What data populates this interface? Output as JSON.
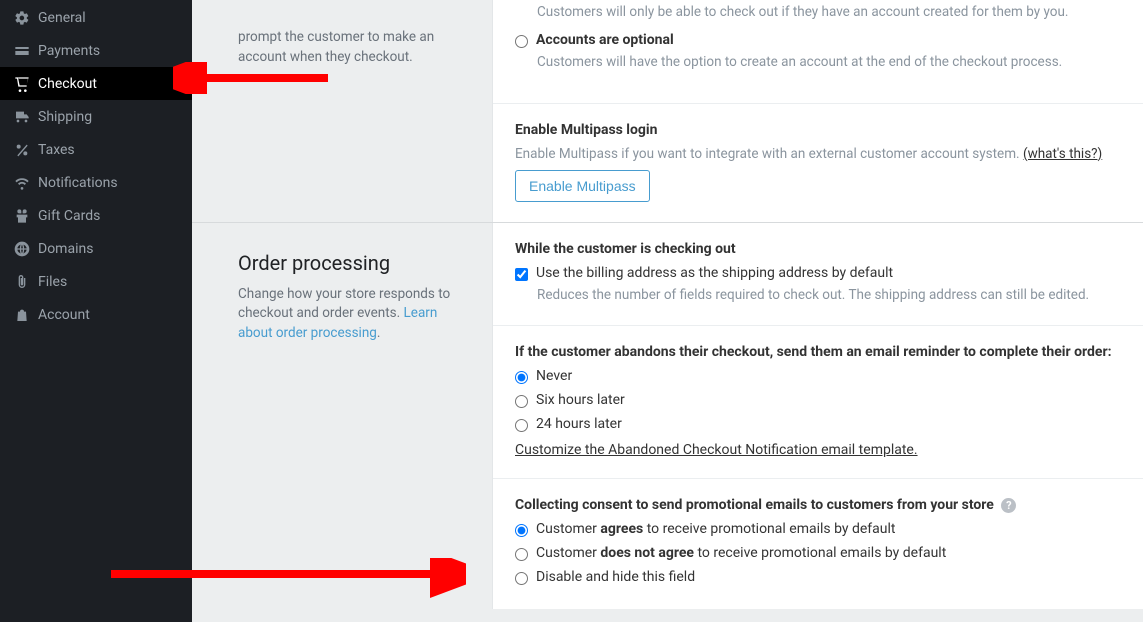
{
  "sidebar": {
    "items": [
      {
        "label": "General",
        "icon": "gear-icon"
      },
      {
        "label": "Payments",
        "icon": "payments-icon"
      },
      {
        "label": "Checkout",
        "icon": "cart-icon"
      },
      {
        "label": "Shipping",
        "icon": "truck-icon"
      },
      {
        "label": "Taxes",
        "icon": "percent-icon"
      },
      {
        "label": "Notifications",
        "icon": "wifi-icon"
      },
      {
        "label": "Gift Cards",
        "icon": "gift-icon"
      },
      {
        "label": "Domains",
        "icon": "globe-icon"
      },
      {
        "label": "Files",
        "icon": "clip-icon"
      },
      {
        "label": "Account",
        "icon": "bag-icon"
      }
    ]
  },
  "section_accounts": {
    "side_fragment": "prompt the customer to make an account when they checkout.",
    "opt_required_desc": "Customers will only be able to check out if they have an account created for them by you.",
    "opt_optional_label": "Accounts are optional",
    "opt_optional_desc": "Customers will have the option to create an account at the end of the checkout process.",
    "multipass_title": "Enable Multipass login",
    "multipass_desc": "Enable Multipass if you want to integrate with an external customer account system. ",
    "multipass_whats": "(what's this?)",
    "multipass_btn": "Enable Multipass"
  },
  "section_order": {
    "title": "Order processing",
    "desc_a": "Change how your store responds to checkout and order events. ",
    "desc_link": "Learn about order processing",
    "block_checkout_title": "While the customer is checking out",
    "chk_billing_label": "Use the billing address as the shipping address by default",
    "chk_billing_desc": "Reduces the number of fields required to check out. The shipping address can still be edited.",
    "block_abandon_title": "If the customer abandons their checkout, send them an email reminder to complete their order:",
    "abandon_opts": [
      "Never",
      "Six hours later",
      "24 hours later"
    ],
    "abandon_link": "Customize the Abandoned Checkout Notification email template.",
    "block_consent_title": "Collecting consent to send promotional emails to customers from your store",
    "consent_opts": {
      "agree_a": "Customer ",
      "agree_b": "agrees",
      "agree_c": " to receive promotional emails by default",
      "disagree_a": "Customer ",
      "disagree_b": "does not agree",
      "disagree_c": " to receive promotional emails by default",
      "disable": "Disable and hide this field"
    }
  }
}
